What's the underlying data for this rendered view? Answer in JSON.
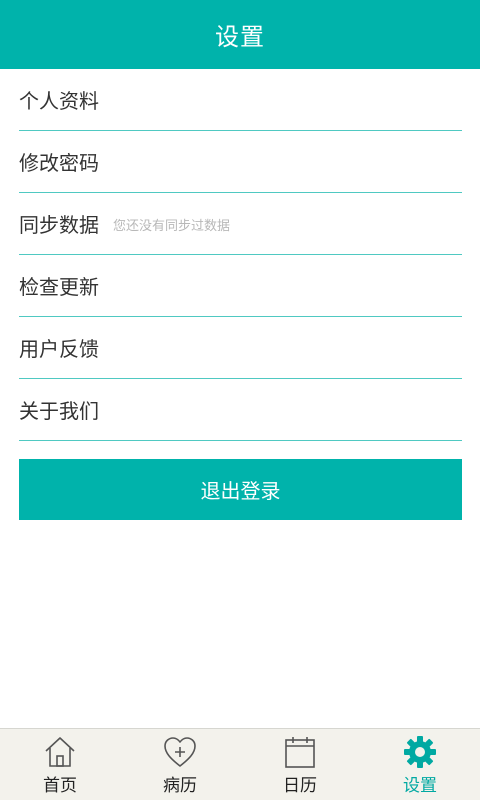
{
  "header": {
    "title": "设置"
  },
  "menu": {
    "items": [
      {
        "label": "个人资料",
        "hint": ""
      },
      {
        "label": "修改密码",
        "hint": ""
      },
      {
        "label": "同步数据",
        "hint": "您还没有同步过数据"
      },
      {
        "label": "检查更新",
        "hint": ""
      },
      {
        "label": "用户反馈",
        "hint": ""
      },
      {
        "label": "关于我们",
        "hint": ""
      }
    ]
  },
  "logout": {
    "label": "退出登录"
  },
  "tabbar": {
    "tabs": [
      {
        "label": "首页",
        "icon": "home-icon"
      },
      {
        "label": "病历",
        "icon": "heart-plus-icon"
      },
      {
        "label": "日历",
        "icon": "calendar-icon"
      },
      {
        "label": "设置",
        "icon": "gear-icon",
        "active": true
      }
    ],
    "active_color": "#00a9a2"
  },
  "colors": {
    "primary": "#00b3ab",
    "divider": "#4fc9c2",
    "tabbar_bg": "#f3f2ec"
  }
}
